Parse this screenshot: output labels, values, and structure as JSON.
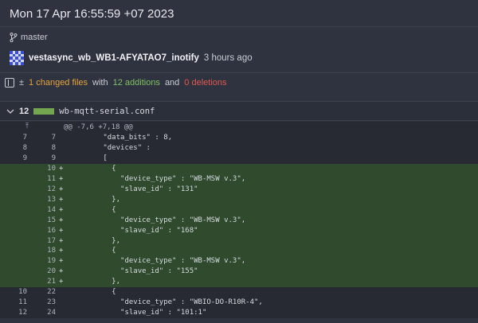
{
  "header": {
    "date": "Mon 17 Apr 16:55:59 +07 2023",
    "branch": "master",
    "commit_message": "vestasync_wb_WB1-AFYATAO7_inotify",
    "commit_time": "3 hours ago"
  },
  "summary": {
    "changed": "1 changed files",
    "with": "with",
    "additions": "12 additions",
    "and": "and",
    "deletions": "0 deletions"
  },
  "file": {
    "count": "12",
    "name": "wb-mqtt-serial.conf",
    "hunk": "@@ -7,6 +7,18 @@"
  },
  "lines": [
    {
      "old": "7",
      "new": "7",
      "sign": "",
      "code": "\"data_bits\" : 8,",
      "indent": 0,
      "type": "ctx"
    },
    {
      "old": "8",
      "new": "8",
      "sign": "",
      "code": "\"devices\" :",
      "indent": 0,
      "type": "ctx"
    },
    {
      "old": "9",
      "new": "9",
      "sign": "",
      "code": "[",
      "indent": 0,
      "type": "ctx"
    },
    {
      "old": "",
      "new": "10",
      "sign": "+",
      "code": "  {",
      "indent": 1,
      "type": "add"
    },
    {
      "old": "",
      "new": "11",
      "sign": "+",
      "code": "    \"device_type\" : \"WB-MSW v.3\",",
      "indent": 2,
      "type": "add"
    },
    {
      "old": "",
      "new": "12",
      "sign": "+",
      "code": "    \"slave_id\" : \"131\"",
      "indent": 2,
      "type": "add"
    },
    {
      "old": "",
      "new": "13",
      "sign": "+",
      "code": "  },",
      "indent": 1,
      "type": "add"
    },
    {
      "old": "",
      "new": "14",
      "sign": "+",
      "code": "  {",
      "indent": 1,
      "type": "add"
    },
    {
      "old": "",
      "new": "15",
      "sign": "+",
      "code": "    \"device_type\" : \"WB-MSW v.3\",",
      "indent": 2,
      "type": "add"
    },
    {
      "old": "",
      "new": "16",
      "sign": "+",
      "code": "    \"slave_id\" : \"168\"",
      "indent": 2,
      "type": "add"
    },
    {
      "old": "",
      "new": "17",
      "sign": "+",
      "code": "  },",
      "indent": 1,
      "type": "add"
    },
    {
      "old": "",
      "new": "18",
      "sign": "+",
      "code": "  {",
      "indent": 1,
      "type": "add"
    },
    {
      "old": "",
      "new": "19",
      "sign": "+",
      "code": "    \"device_type\" : \"WB-MSW v.3\",",
      "indent": 2,
      "type": "add"
    },
    {
      "old": "",
      "new": "20",
      "sign": "+",
      "code": "    \"slave_id\" : \"155\"",
      "indent": 2,
      "type": "add"
    },
    {
      "old": "",
      "new": "21",
      "sign": "+",
      "code": "  },",
      "indent": 1,
      "type": "add"
    },
    {
      "old": "10",
      "new": "22",
      "sign": "",
      "code": "  {",
      "indent": 1,
      "type": "ctx"
    },
    {
      "old": "11",
      "new": "23",
      "sign": "",
      "code": "    \"device_type\" : \"WBIO-DO-R10R-4\",",
      "indent": 2,
      "type": "ctx"
    },
    {
      "old": "12",
      "new": "24",
      "sign": "",
      "code": "    \"slave_id\" : \"101:1\"",
      "indent": 2,
      "type": "ctx"
    }
  ],
  "colors": {
    "background": "#2f3340",
    "added_line": "#2f4a2c",
    "changed": "#e3a33b",
    "additions": "#7fbf62",
    "deletions": "#e0584f"
  }
}
